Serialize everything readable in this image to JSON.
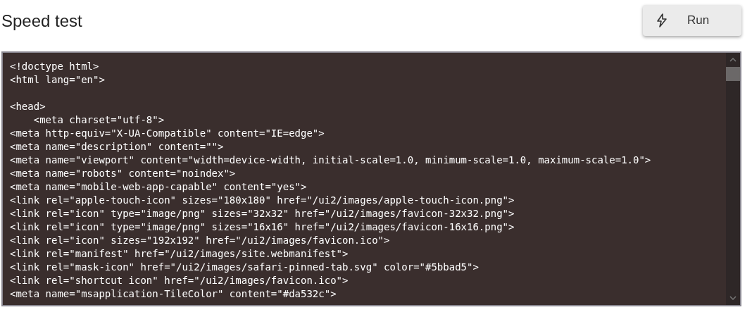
{
  "page": {
    "title": "Speed test"
  },
  "run_button": {
    "label": "Run"
  },
  "code_editor": {
    "blocks": [
      [
        "<!doctype html>",
        "<html lang=\"en\">"
      ],
      [
        "<head>",
        "    <meta charset=\"utf-8\">",
        "<meta http-equiv=\"X-UA-Compatible\" content=\"IE=edge\">",
        "<meta name=\"description\" content=\"\">",
        "<meta name=\"viewport\" content=\"width=device-width, initial-scale=1.0, minimum-scale=1.0, maximum-scale=1.0\">",
        "<meta name=\"robots\" content=\"noindex\">",
        "<meta name=\"mobile-web-app-capable\" content=\"yes\">",
        "<link rel=\"apple-touch-icon\" sizes=\"180x180\" href=\"/ui2/images/apple-touch-icon.png\">",
        "<link rel=\"icon\" type=\"image/png\" sizes=\"32x32\" href=\"/ui2/images/favicon-32x32.png\">",
        "<link rel=\"icon\" type=\"image/png\" sizes=\"16x16\" href=\"/ui2/images/favicon-16x16.png\">",
        "<link rel=\"icon\" sizes=\"192x192\" href=\"/ui2/images/favicon.ico\">",
        "<link rel=\"manifest\" href=\"/ui2/images/site.webmanifest\">",
        "<link rel=\"mask-icon\" href=\"/ui2/images/safari-pinned-tab.svg\" color=\"#5bbad5\">",
        "<link rel=\"shortcut icon\" href=\"/ui2/images/favicon.ico\">",
        "<meta name=\"msapplication-TileColor\" content=\"#da532c\">"
      ]
    ]
  }
}
